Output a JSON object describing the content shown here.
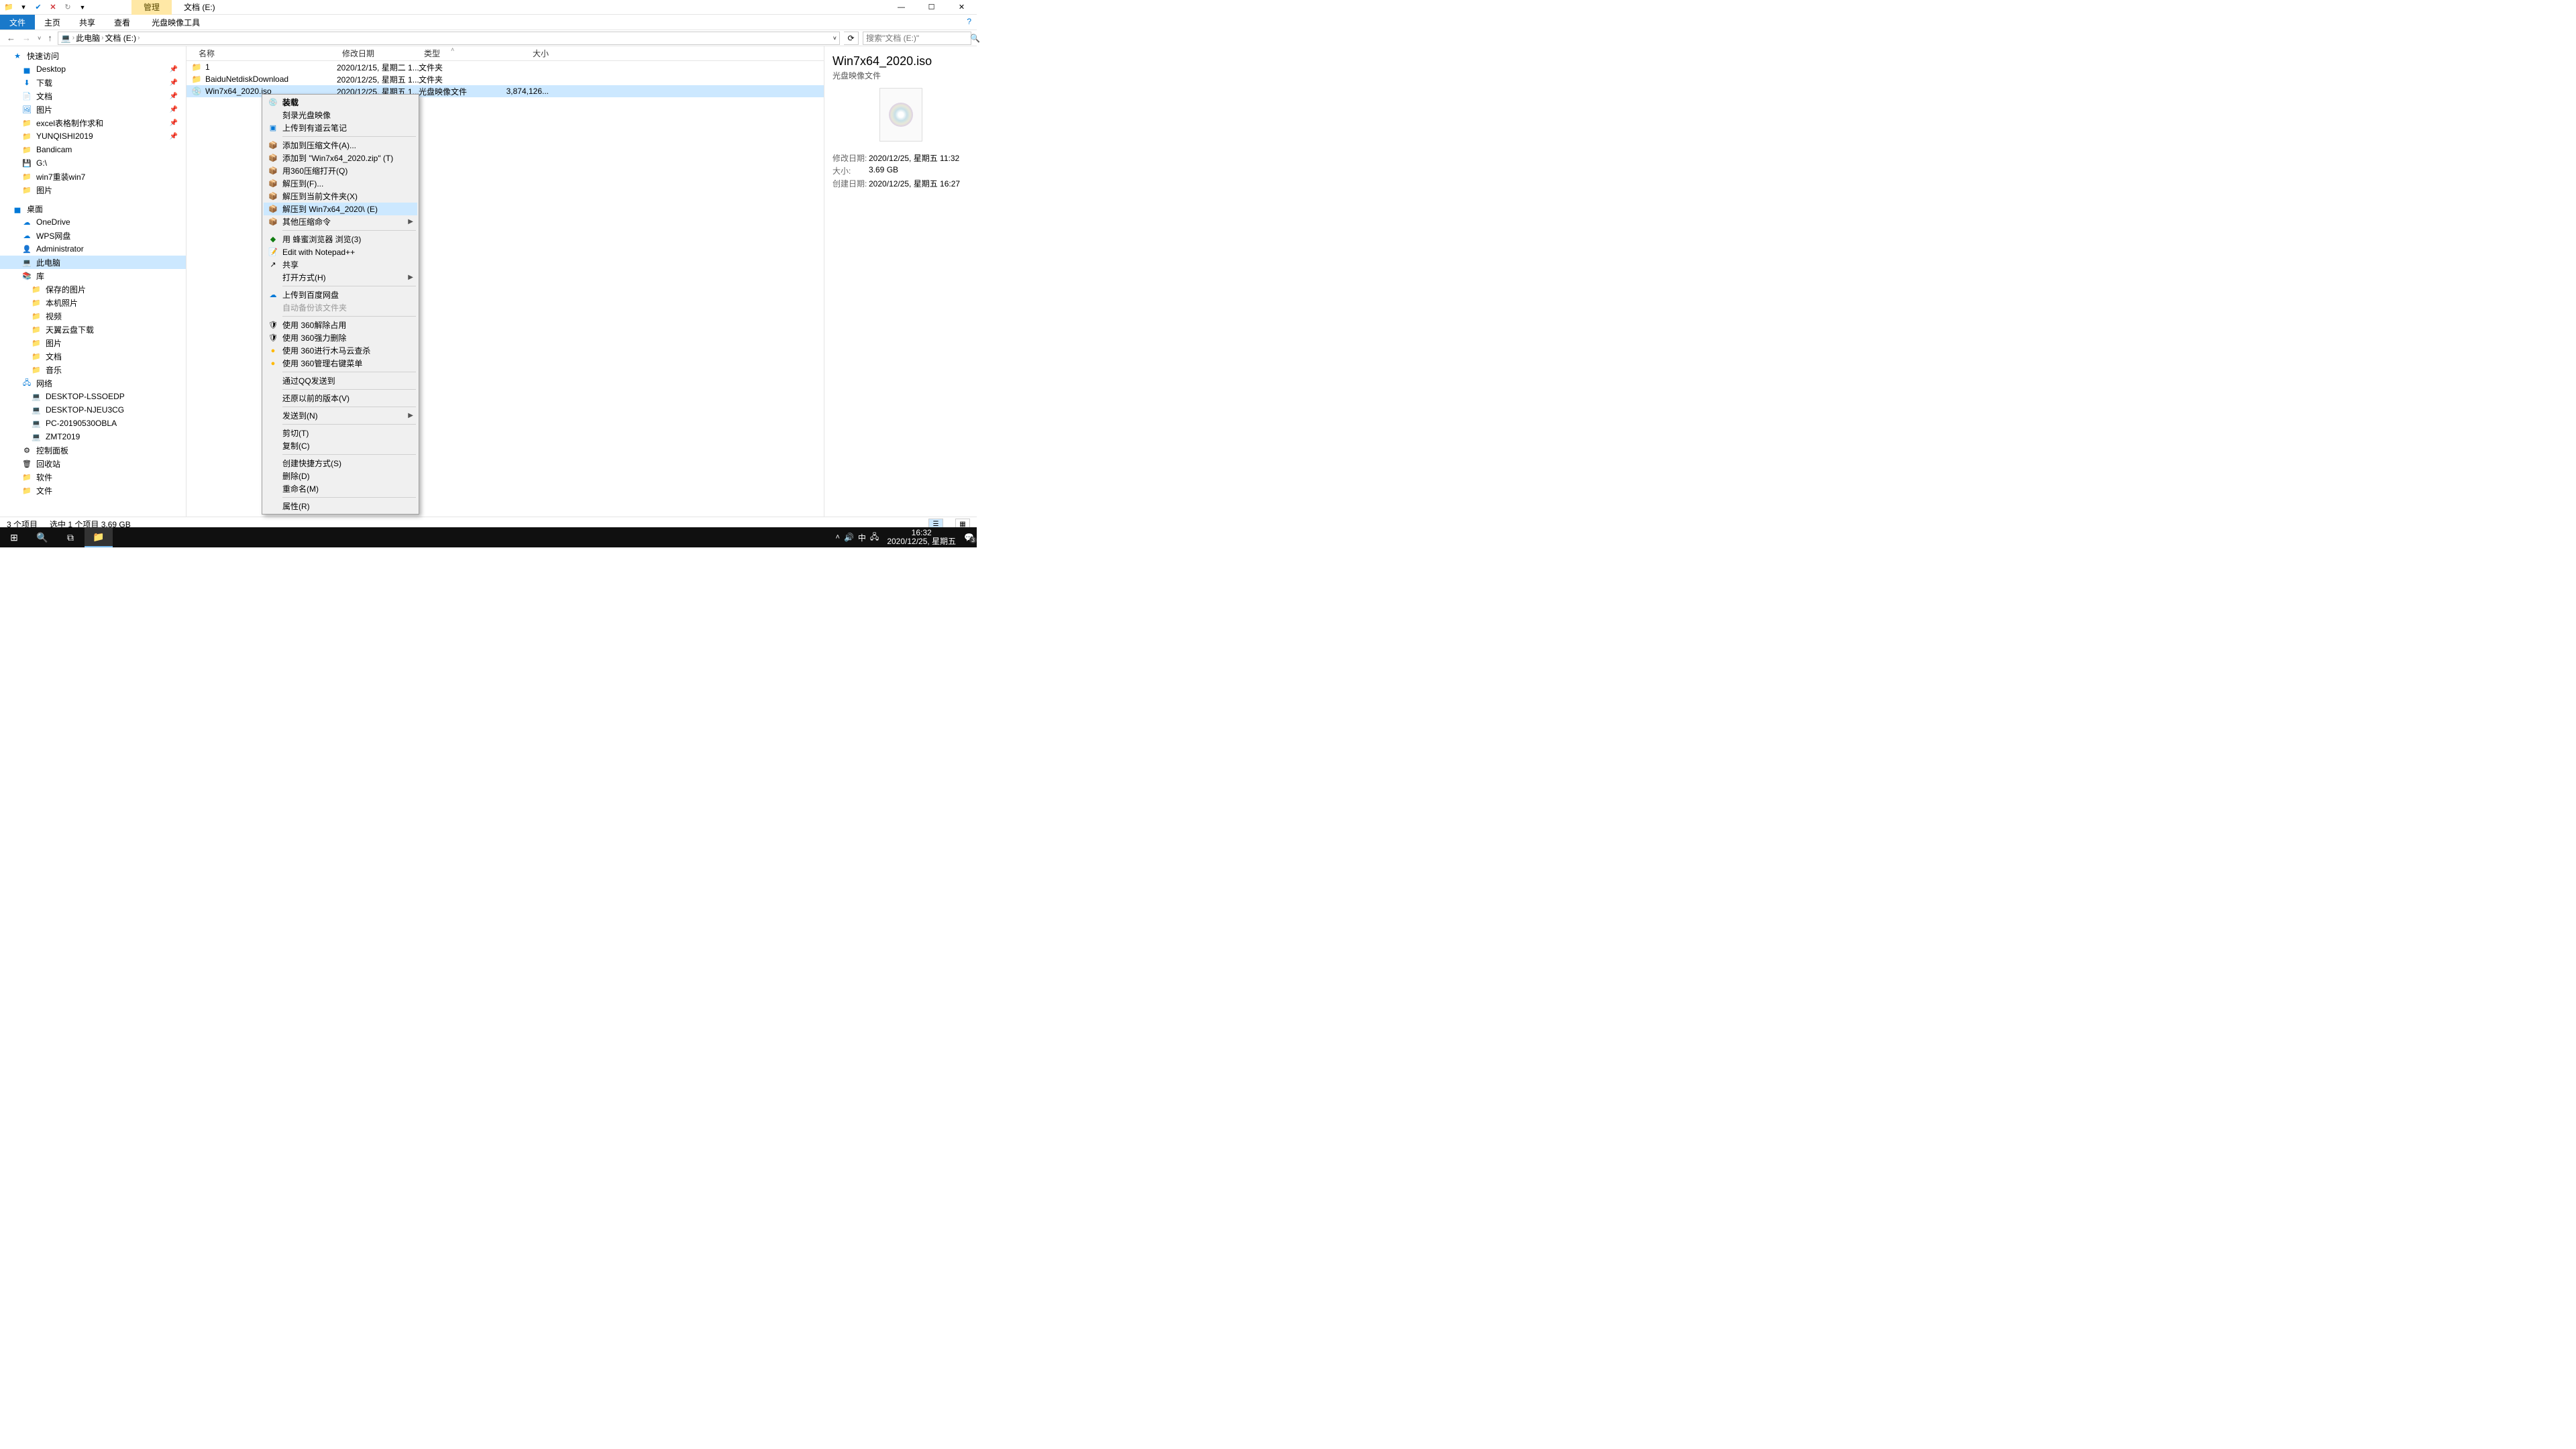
{
  "titlebar": {
    "tab_manage": "管理",
    "tab_location": "文档 (E:)"
  },
  "ribbon": {
    "file": "文件",
    "home": "主页",
    "share": "共享",
    "view": "查看",
    "tools": "光盘映像工具"
  },
  "breadcrumb": {
    "pc": "此电脑",
    "drive": "文档 (E:)"
  },
  "search": {
    "placeholder": "搜索\"文档 (E:)\""
  },
  "sidebar": {
    "quick": "快速访问",
    "items_quick": [
      "Desktop",
      "下载",
      "文档",
      "图片",
      "excel表格制作求和",
      "YUNQISHI2019",
      "Bandicam",
      "G:\\",
      "win7重装win7",
      "图片"
    ],
    "desktop": "桌面",
    "items_desktop": [
      "OneDrive",
      "WPS网盘",
      "Administrator",
      "此电脑",
      "库"
    ],
    "lib_items": [
      "保存的图片",
      "本机照片",
      "视频",
      "天翼云盘下载",
      "图片",
      "文档",
      "音乐"
    ],
    "network": "网络",
    "net_items": [
      "DESKTOP-LSSOEDP",
      "DESKTOP-NJEU3CG",
      "PC-20190530OBLA",
      "ZMT2019"
    ],
    "control": "控制面板",
    "recycle": "回收站",
    "software": "软件",
    "docs": "文件"
  },
  "columns": {
    "name": "名称",
    "date": "修改日期",
    "type": "类型",
    "size": "大小"
  },
  "rows": [
    {
      "name": "1",
      "date": "2020/12/15, 星期二 1...",
      "type": "文件夹",
      "size": ""
    },
    {
      "name": "BaiduNetdiskDownload",
      "date": "2020/12/25, 星期五 1...",
      "type": "文件夹",
      "size": ""
    },
    {
      "name": "Win7x64_2020.iso",
      "date": "2020/12/25, 星期五 1...",
      "type": "光盘映像文件",
      "size": "3,874,126..."
    }
  ],
  "context": {
    "mount": "装载",
    "burn": "刻录光盘映像",
    "youdao": "上传到有道云笔记",
    "addarchive": "添加到压缩文件(A)...",
    "addzip": "添加到 \"Win7x64_2020.zip\" (T)",
    "open360": "用360压缩打开(Q)",
    "extractto": "解压到(F)...",
    "extracthere": "解压到当前文件夹(X)",
    "extractfolder": "解压到 Win7x64_2020\\ (E)",
    "othercomp": "其他压缩命令",
    "browse": "用 蜂蜜浏览器 浏览(3)",
    "notepad": "Edit with Notepad++",
    "share": "共享",
    "openwith": "打开方式(H)",
    "baidu": "上传到百度网盘",
    "autobak": "自动备份该文件夹",
    "360unlock": "使用 360解除占用",
    "360del": "使用 360强力删除",
    "360scan": "使用 360进行木马云查杀",
    "360menu": "使用 360管理右键菜单",
    "qqsend": "通过QQ发送到",
    "restore": "还原以前的版本(V)",
    "sendto": "发送到(N)",
    "cut": "剪切(T)",
    "copy": "复制(C)",
    "shortcut": "创建快捷方式(S)",
    "delete": "删除(D)",
    "rename": "重命名(M)",
    "props": "属性(R)"
  },
  "details": {
    "title": "Win7x64_2020.iso",
    "subtitle": "光盘映像文件",
    "mod_label": "修改日期:",
    "mod": "2020/12/25, 星期五 11:32",
    "size_label": "大小:",
    "size": "3.69 GB",
    "create_label": "创建日期:",
    "create": "2020/12/25, 星期五 16:27"
  },
  "status": {
    "count": "3 个项目",
    "sel": "选中 1 个项目  3.69 GB"
  },
  "taskbar": {
    "time": "16:32",
    "date": "2020/12/25, 星期五",
    "ime": "中",
    "notif": "3"
  }
}
